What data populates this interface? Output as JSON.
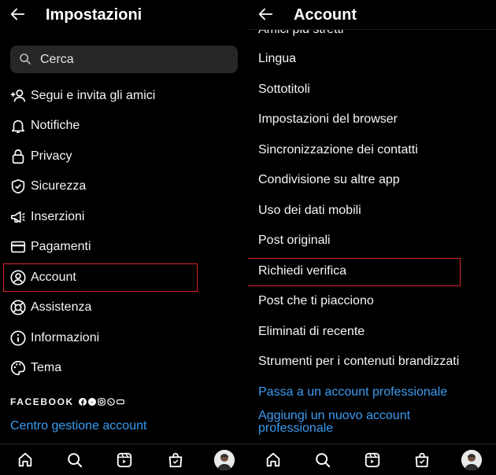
{
  "left": {
    "title": "Impostazioni",
    "search": {
      "placeholder": "Cerca"
    },
    "items": [
      {
        "label": "Segui e invita gli amici",
        "icon": "add-person-icon"
      },
      {
        "label": "Notifiche",
        "icon": "bell-icon"
      },
      {
        "label": "Privacy",
        "icon": "lock-icon"
      },
      {
        "label": "Sicurezza",
        "icon": "shield-icon"
      },
      {
        "label": "Inserzioni",
        "icon": "megaphone-icon"
      },
      {
        "label": "Pagamenti",
        "icon": "card-icon"
      },
      {
        "label": "Account",
        "icon": "person-circle-icon"
      },
      {
        "label": "Assistenza",
        "icon": "lifebuoy-icon"
      },
      {
        "label": "Informazioni",
        "icon": "info-icon"
      },
      {
        "label": "Tema",
        "icon": "palette-icon"
      }
    ],
    "facebook_label": "FACEBOOK",
    "accounts_center": "Centro gestione account"
  },
  "right": {
    "title": "Account",
    "partial_top_item": "Amici più stretti",
    "items": [
      "Lingua",
      "Sottotitoli",
      "Impostazioni del browser",
      "Sincronizzazione dei contatti",
      "Condivisione su altre app",
      "Uso dei dati mobili",
      "Post originali",
      "Richiedi verifica",
      "Post che ti piacciono",
      "Eliminati di recente",
      "Strumenti per i contenuti brandizzati"
    ],
    "links": [
      "Passa a un account professionale",
      "Aggiungi un nuovo account professionale"
    ]
  },
  "tabbar": [
    "home-icon",
    "search-icon",
    "reels-icon",
    "shop-icon",
    "profile-avatar"
  ],
  "colors": {
    "background": "#000000",
    "text": "#f5f5f5",
    "link": "#3b9cf2",
    "highlight": "#d9262b",
    "search_bg": "#262626"
  }
}
